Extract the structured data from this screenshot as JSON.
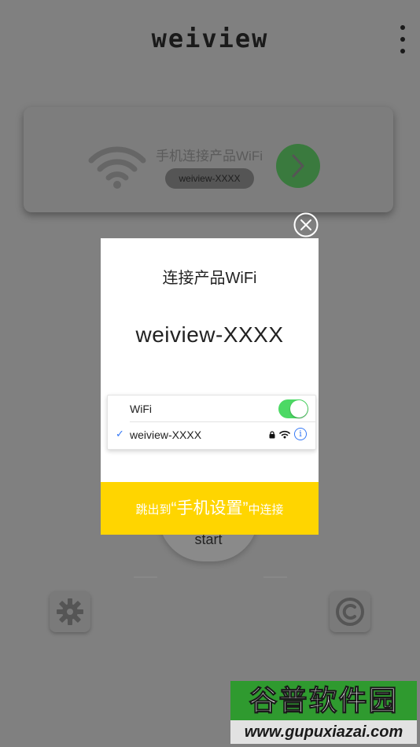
{
  "app": {
    "title": "weiview"
  },
  "wifi_card": {
    "label": "手机连接产品WiFi",
    "ssid": "weiview-XXXX"
  },
  "start": {
    "label": "start"
  },
  "dialog": {
    "title": "连接产品WiFi",
    "ssid": "weiview-XXXX",
    "settings_preview": {
      "wifi_label": "WiFi",
      "wifi_enabled": true,
      "check": "✓",
      "network_name": "weiview-XXXX",
      "info_glyph": "i"
    },
    "action": {
      "prefix": "跳出到",
      "highlight": "“手机设置”",
      "suffix": "中连接"
    }
  },
  "icons": [
    "menu-dots-icon",
    "wifi-icon",
    "chevron-right-icon",
    "close-icon",
    "gear-icon",
    "copyright-icon",
    "lock-icon",
    "wifi-signal-icon",
    "info-icon",
    "check-icon"
  ],
  "watermark": {
    "brand": "谷普软件园",
    "url": "www.gupuxiazai.com"
  },
  "colors": {
    "overlay_bg": "#808080",
    "action_yellow": "#ffd500",
    "toggle_green": "#4cd964",
    "go_green": "#3a7a3e",
    "ios_blue": "#3478f6"
  }
}
